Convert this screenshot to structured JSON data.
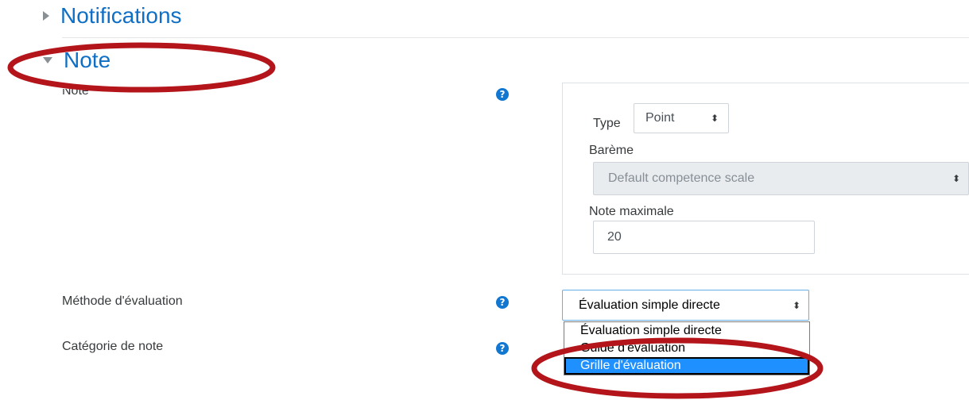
{
  "sections": {
    "notifications": {
      "title": "Notifications",
      "expanded": false
    },
    "note": {
      "title": "Note",
      "expanded": true
    }
  },
  "note_group": {
    "label": "Note",
    "type_label": "Type",
    "type_value": "Point",
    "bareme_label": "Barème",
    "bareme_value": "Default competence scale",
    "max_label": "Note maximale",
    "max_value": "20"
  },
  "grading_method": {
    "label": "Méthode d'évaluation",
    "selected": "Évaluation simple directe",
    "options": [
      "Évaluation simple directe",
      "Guide d'évaluation",
      "Grille d'évaluation"
    ],
    "highlighted_index": 2
  },
  "grade_category": {
    "label": "Catégorie de note"
  },
  "icons": {
    "help": "?",
    "select_arrows": "⬍"
  },
  "colors": {
    "link_blue": "#0f6fc5",
    "help_blue": "#1177d1",
    "highlight": "#1e90ff",
    "annotation_red": "#b3151b"
  }
}
